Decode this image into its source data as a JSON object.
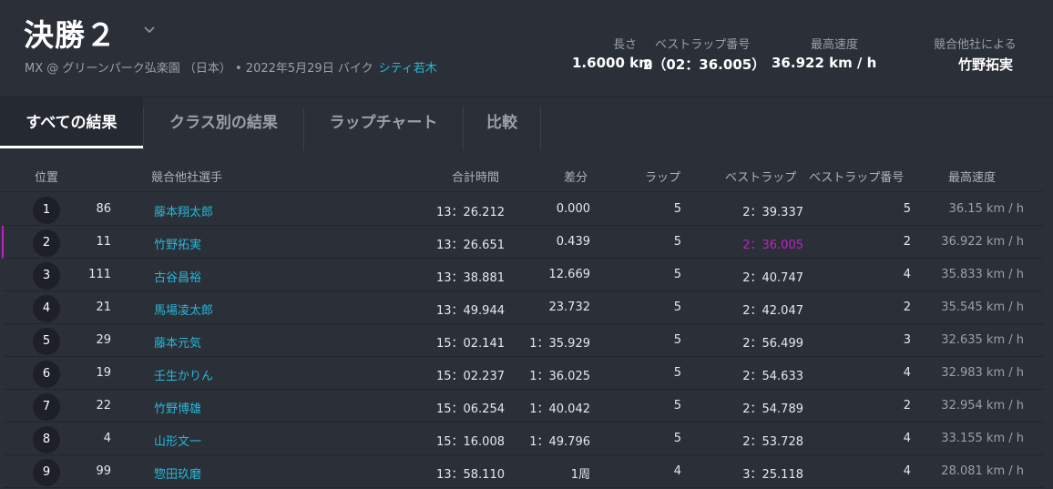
{
  "header": {
    "title": "決勝２",
    "subtitle_info": "MX @ グリーンパーク弘楽園 （日本） • 2022年5月29日 バイク",
    "subtitle_link": "シティ若木",
    "stats": {
      "length_label": "長さ",
      "length_value": "1.6000 km",
      "best_lap_no_label": "ベストラップ番号",
      "best_lap_no_value": "2（02：36.005）",
      "top_speed_label": "最高速度",
      "top_speed_value": "36.922 km / h",
      "by_label": "競合他社による",
      "by_value": "竹野拓実"
    }
  },
  "tabs": [
    {
      "label": "すべての結果",
      "active": true
    },
    {
      "label": "クラス別の結果",
      "active": false
    },
    {
      "label": "ラップチャート",
      "active": false
    },
    {
      "label": "比較",
      "active": false
    }
  ],
  "table": {
    "columns": {
      "pos": "位置",
      "rider": "競合他社選手",
      "total": "合計時間",
      "gap": "差分",
      "laps": "ラップ",
      "best_lap": "ベストラップ",
      "best_lap_no": "ベストラップ番号",
      "top_speed": "最高速度"
    },
    "rows": [
      {
        "pos": "1",
        "num": "86",
        "rider": "藤本翔太郎",
        "total": "13：26.212",
        "gap": "0.000",
        "laps": "5",
        "best": "2：39.337",
        "best_no": "5",
        "speed": "36.15 km / h"
      },
      {
        "pos": "2",
        "num": "11",
        "rider": "竹野拓実",
        "total": "13：26.651",
        "gap": "0.439",
        "laps": "5",
        "best": "2：36.005",
        "best_no": "2",
        "speed": "36.922 km / h"
      },
      {
        "pos": "3",
        "num": "111",
        "rider": "古谷昌裕",
        "total": "13：38.881",
        "gap": "12.669",
        "laps": "5",
        "best": "2：40.747",
        "best_no": "4",
        "speed": "35.833 km / h"
      },
      {
        "pos": "4",
        "num": "21",
        "rider": "馬場凌太郎",
        "total": "13：49.944",
        "gap": "23.732",
        "laps": "5",
        "best": "2：42.047",
        "best_no": "2",
        "speed": "35.545 km / h"
      },
      {
        "pos": "5",
        "num": "29",
        "rider": "藤本元気",
        "total": "15：02.141",
        "gap": "1：35.929",
        "laps": "5",
        "best": "2：56.499",
        "best_no": "3",
        "speed": "32.635 km / h"
      },
      {
        "pos": "6",
        "num": "19",
        "rider": "壬生かりん",
        "total": "15：02.237",
        "gap": "1：36.025",
        "laps": "5",
        "best": "2：54.633",
        "best_no": "4",
        "speed": "32.983 km / h"
      },
      {
        "pos": "7",
        "num": "22",
        "rider": "竹野博雄",
        "total": "15：06.254",
        "gap": "1：40.042",
        "laps": "5",
        "best": "2：54.789",
        "best_no": "2",
        "speed": "32.954 km / h"
      },
      {
        "pos": "8",
        "num": "4",
        "rider": "山形文一",
        "total": "15：16.008",
        "gap": "1：49.796",
        "laps": "5",
        "best": "2：53.728",
        "best_no": "4",
        "speed": "33.155 km / h"
      },
      {
        "pos": "9",
        "num": "99",
        "rider": "惣田玖磨",
        "total": "13：58.110",
        "gap": "1周",
        "laps": "4",
        "best": "3：25.118",
        "best_no": "4",
        "speed": "28.081 km / h"
      }
    ]
  },
  "colors": {
    "accent_link": "#27b8d6",
    "best_lap_highlight": "#c020c8",
    "background": "#2b2f38"
  }
}
